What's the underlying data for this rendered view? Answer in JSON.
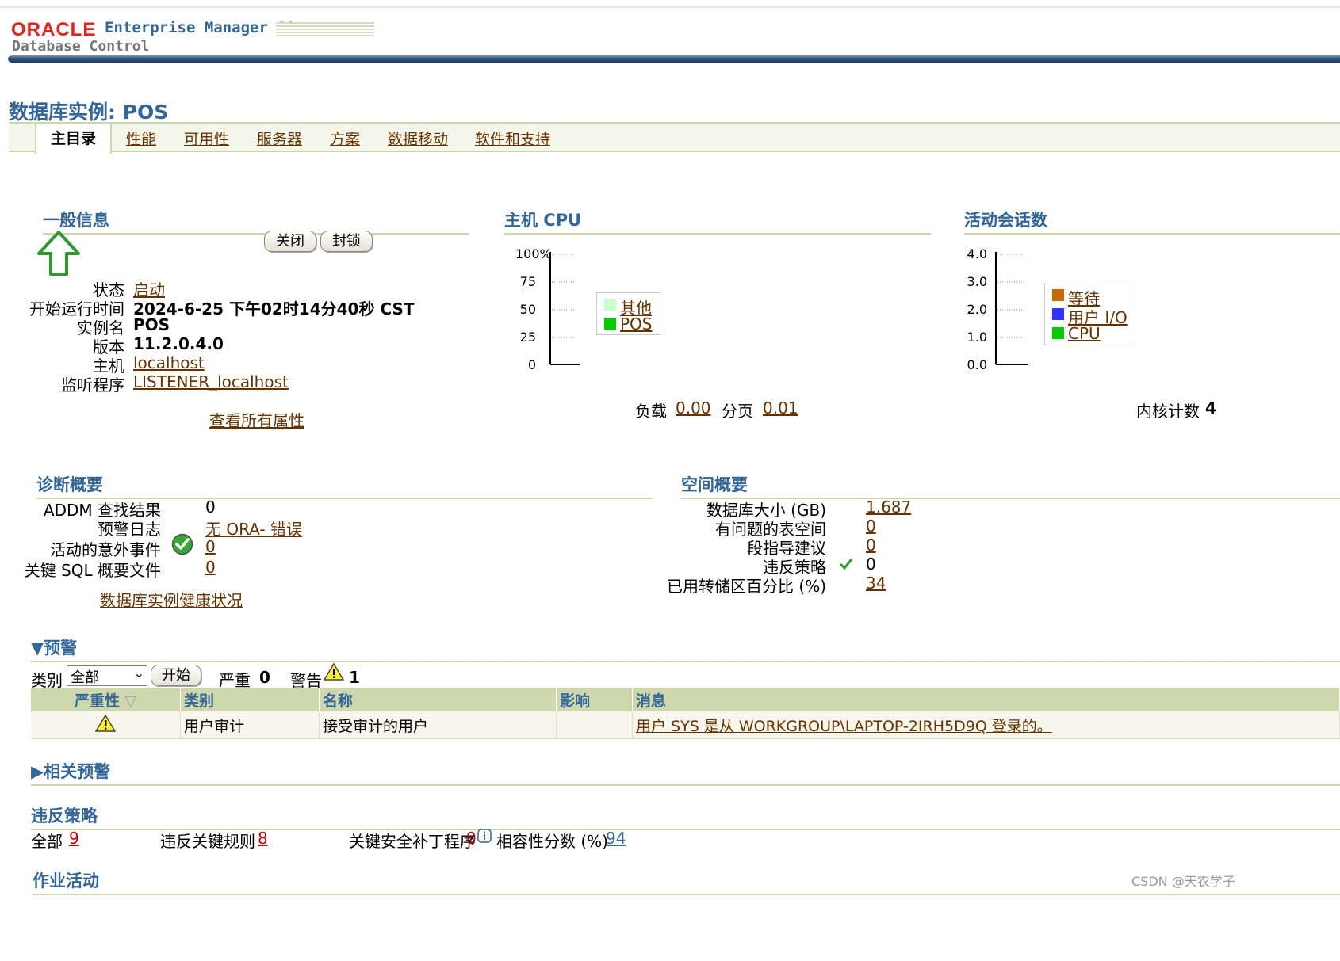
{
  "header": {
    "brand_oracle": "ORACLE",
    "brand_product": "Enterprise Manager 11g",
    "brand_sub": "Database Control"
  },
  "page_title": "数据库实例: POS",
  "tabs": [
    {
      "label": "主目录",
      "active": true
    },
    {
      "label": "性能"
    },
    {
      "label": "可用性"
    },
    {
      "label": "服务器"
    },
    {
      "label": "方案"
    },
    {
      "label": "数据移动"
    },
    {
      "label": "软件和支持"
    }
  ],
  "general": {
    "title": "一般信息",
    "btn_shutdown": "关闭",
    "btn_blackout": "封锁",
    "rows": [
      {
        "label": "状态",
        "value": "启动"
      },
      {
        "label": "开始运行时间",
        "value": "2024-6-25 下午02时14分40秒 CST"
      },
      {
        "label": "实例名",
        "value": "POS"
      },
      {
        "label": "版本",
        "value": "11.2.0.4.0"
      },
      {
        "label": "主机",
        "value": "localhost"
      },
      {
        "label": "监听程序",
        "value": "LISTENER_localhost"
      }
    ],
    "view_all": "查看所有属性"
  },
  "cpu": {
    "title": "主机 CPU",
    "ticks": [
      "100%",
      "75",
      "50",
      "25",
      "0"
    ],
    "legend": [
      "其他",
      "POS"
    ],
    "load_label": "负载",
    "load_value": "0.00",
    "paging_label": "分页",
    "paging_value": "0.01"
  },
  "sessions": {
    "title": "活动会话数",
    "ticks": [
      "4.0",
      "3.0",
      "2.0",
      "1.0",
      "0.0"
    ],
    "legend": [
      "等待",
      "用户 I/O",
      "CPU"
    ],
    "cores_label": "内核计数",
    "cores_value": "4"
  },
  "colors": {
    "accent": "#336699",
    "link": "#663300",
    "legend_other": "#ccffcc",
    "legend_pos": "#00cc00",
    "legend_wait": "#cc6600",
    "legend_userio": "#3333ff",
    "legend_cpu": "#00cc00"
  },
  "diagnostics": {
    "title": "诊断概要",
    "rows": [
      {
        "label": "ADDM 查找结果",
        "value": "0"
      },
      {
        "label": "预警日志",
        "value": "无 ORA- 错误"
      },
      {
        "label": "活动的意外事件",
        "value": "0"
      },
      {
        "label": "关键 SQL 概要文件",
        "value": "0"
      }
    ],
    "health_link": "数据库实例健康状况"
  },
  "space": {
    "title": "空间概要",
    "rows": [
      {
        "label": "数据库大小 (GB)",
        "value": "1.687"
      },
      {
        "label": "有问题的表空间",
        "value": "0"
      },
      {
        "label": "段指导建议",
        "value": "0"
      },
      {
        "label": "违反策略",
        "value": "0"
      },
      {
        "label": "已用转储区百分比 (%)",
        "value": "34"
      }
    ]
  },
  "alerts": {
    "title": "预警",
    "category_label": "类别",
    "category_value": "全部",
    "go_button": "开始",
    "critical_label": "严重",
    "critical_value": "0",
    "warning_label": "警告",
    "warning_value": "1",
    "columns": [
      "严重性",
      "类别",
      "名称",
      "影响",
      "消息"
    ],
    "rows": [
      {
        "severity": "warning",
        "category": "用户审计",
        "name": "接受审计的用户",
        "impact": "",
        "message": "用户 SYS 是从 WORKGROUP\\LAPTOP-2IRH5D9Q 登录的。"
      }
    ]
  },
  "related_alerts": {
    "title": "相关预警"
  },
  "policy": {
    "title": "违反策略",
    "all_label": "全部",
    "all_value": "9",
    "critical_rules_label": "违反关键规则",
    "critical_rules_value": "8",
    "patches_label": "关键安全补丁程序",
    "patches_value": "0",
    "compliance_label": "相容性分数 (%)",
    "compliance_value": "94"
  },
  "jobs": {
    "title": "作业活动"
  },
  "watermark": "CSDN @天农学子"
}
